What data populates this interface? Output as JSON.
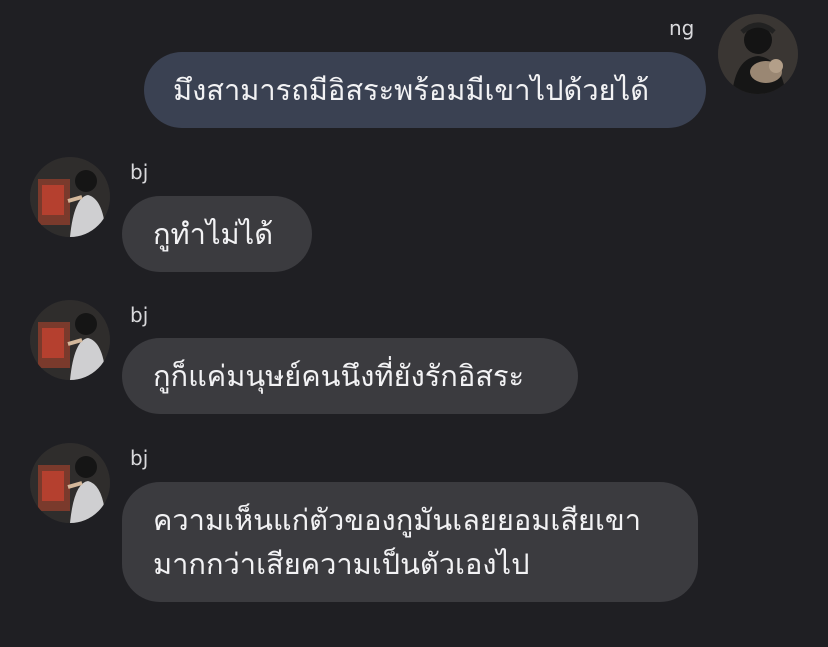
{
  "messages": [
    {
      "sender": "ng",
      "direction": "outgoing",
      "lines": [
        "มึงสามารถมีอิสระพร้อมมีเขาไปด้วยได้"
      ]
    },
    {
      "sender": "bj",
      "direction": "incoming",
      "lines": [
        "กูทำไม่ได้"
      ]
    },
    {
      "sender": "bj",
      "direction": "incoming",
      "lines": [
        "กูก็แค่มนุษย์คนนึงที่ยังรักอิสระ"
      ]
    },
    {
      "sender": "bj",
      "direction": "incoming",
      "lines": [
        "ความเห็นแก่ตัวของกูมันเลยยอมเสียเขา",
        "มากกว่าเสียความเป็นตัวเองไป"
      ]
    }
  ],
  "colors": {
    "background": "#1f1f23",
    "outgoing_bubble": "#3a4152",
    "incoming_bubble": "#3b3b3f",
    "text": "#f2f2f4",
    "sender_name": "#d9d9dc"
  },
  "icons": {
    "ng_avatar": "profile-photo-person-with-cat",
    "bj_avatar": "profile-photo-person-painting"
  }
}
